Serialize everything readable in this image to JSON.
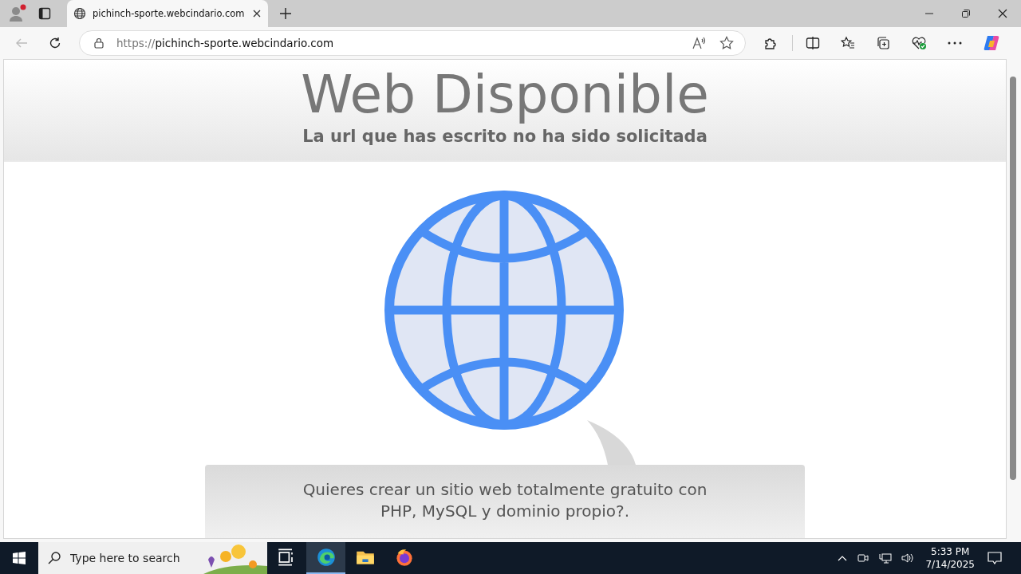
{
  "browser": {
    "tab": {
      "title": "pichinch-sporte.webcindario.com",
      "selected": true
    },
    "address": {
      "scheme": "https://",
      "host": "pichinch-sporte.webcindario.com"
    }
  },
  "page": {
    "title": "Web Disponible",
    "subtitle": "La url que has escrito no ha sido solicitada",
    "message": "Quieres crear un sitio web totalmente gratuito con PHP, MySQL y dominio propio?."
  },
  "taskbar": {
    "search": {
      "placeholder": "Type here to search"
    },
    "apps": [
      {
        "kind": "taskview",
        "selected": false
      },
      {
        "kind": "edge",
        "selected": true
      },
      {
        "kind": "explorer",
        "selected": false
      },
      {
        "kind": "firefox",
        "selected": false
      }
    ],
    "time": "5:33 PM",
    "date": "7/14/2025"
  }
}
